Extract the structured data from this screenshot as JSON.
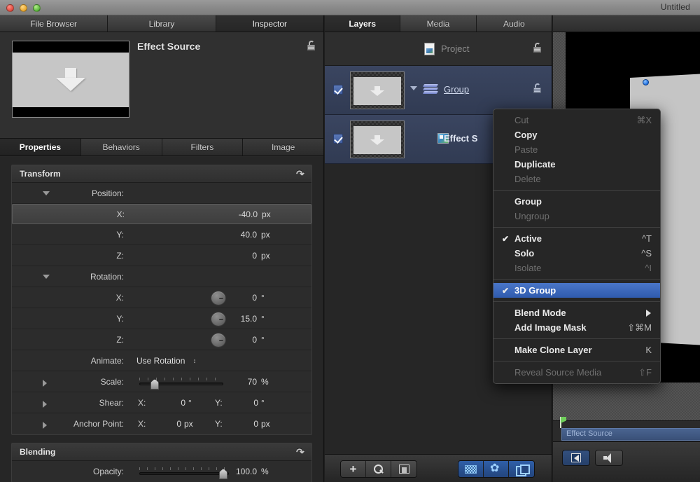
{
  "window": {
    "title": "Untitled"
  },
  "inspector": {
    "tabs": [
      {
        "label": "File Browser",
        "active": false
      },
      {
        "label": "Library",
        "active": false
      },
      {
        "label": "Inspector",
        "active": true
      }
    ],
    "header_title": "Effect Source",
    "subtabs": [
      {
        "label": "Properties",
        "active": true
      },
      {
        "label": "Behaviors",
        "active": false
      },
      {
        "label": "Filters",
        "active": false
      },
      {
        "label": "Image",
        "active": false
      }
    ],
    "transform": {
      "title": "Transform",
      "position_label": "Position:",
      "position": [
        {
          "label": "X:",
          "value": "-40.0",
          "unit": "px",
          "selected": true
        },
        {
          "label": "Y:",
          "value": "40.0",
          "unit": "px",
          "selected": false
        },
        {
          "label": "Z:",
          "value": "0",
          "unit": "px",
          "selected": false
        }
      ],
      "rotation_label": "Rotation:",
      "rotation": [
        {
          "label": "X:",
          "value": "0",
          "unit": "°"
        },
        {
          "label": "Y:",
          "value": "15.0",
          "unit": "°"
        },
        {
          "label": "Z:",
          "value": "0",
          "unit": "°"
        }
      ],
      "animate_label": "Animate:",
      "animate_value": "Use Rotation",
      "scale_label": "Scale:",
      "scale_value": "70",
      "scale_unit": "%",
      "shear_label": "Shear:",
      "shear_x_label": "X:",
      "shear_x_value": "0",
      "shear_x_unit": "°",
      "shear_y_label": "Y:",
      "shear_y_value": "0",
      "shear_y_unit": "°",
      "anchor_label": "Anchor Point:",
      "anchor_x_label": "X:",
      "anchor_x_value": "0",
      "anchor_x_unit": "px",
      "anchor_y_label": "Y:",
      "anchor_y_value": "0",
      "anchor_y_unit": "px"
    },
    "blending": {
      "title": "Blending",
      "opacity_label": "Opacity:",
      "opacity_value": "100.0",
      "opacity_unit": "%"
    }
  },
  "layers_panel": {
    "tabs": [
      {
        "label": "Layers",
        "active": true
      },
      {
        "label": "Media",
        "active": false
      },
      {
        "label": "Audio",
        "active": false
      }
    ],
    "project_row": {
      "label": "Project"
    },
    "rows": [
      {
        "name": "Group",
        "checked": true,
        "type": "group"
      },
      {
        "name": "Effect S",
        "checked": true,
        "type": "image"
      }
    ]
  },
  "context_menu": {
    "items": [
      {
        "label": "Cut",
        "shortcut": "⌘X",
        "state": "disabled",
        "check": false
      },
      {
        "label": "Copy",
        "shortcut": "",
        "state": "enabled",
        "check": false
      },
      {
        "label": "Paste",
        "shortcut": "",
        "state": "disabled",
        "check": false
      },
      {
        "label": "Duplicate",
        "shortcut": "",
        "state": "enabled",
        "check": false
      },
      {
        "label": "Delete",
        "shortcut": "",
        "state": "disabled",
        "check": false
      },
      {
        "label": "-SEP-"
      },
      {
        "label": "Group",
        "shortcut": "",
        "state": "enabled",
        "check": false
      },
      {
        "label": "Ungroup",
        "shortcut": "",
        "state": "disabled",
        "check": false
      },
      {
        "label": "-SEP-"
      },
      {
        "label": "Active",
        "shortcut": "^T",
        "state": "enabled",
        "check": true
      },
      {
        "label": "Solo",
        "shortcut": "^S",
        "state": "enabled",
        "check": false
      },
      {
        "label": "Isolate",
        "shortcut": "^I",
        "state": "disabled",
        "check": false
      },
      {
        "label": "-SEP-"
      },
      {
        "label": "3D Group",
        "shortcut": "",
        "state": "highlighted",
        "check": true
      },
      {
        "label": "-SEP-"
      },
      {
        "label": "Blend Mode",
        "shortcut": "",
        "state": "submenu",
        "check": false
      },
      {
        "label": "Add Image Mask",
        "shortcut": "⇧⌘M",
        "state": "enabled",
        "check": false
      },
      {
        "label": "-SEP-"
      },
      {
        "label": "Make Clone Layer",
        "shortcut": "K",
        "state": "enabled",
        "check": false
      },
      {
        "label": "-SEP-"
      },
      {
        "label": "Reveal Source Media",
        "shortcut": "⇧F",
        "state": "disabled",
        "check": false
      }
    ]
  },
  "timeline": {
    "clip_label": "Effect Source"
  },
  "colors": {
    "accent_blue": "#2f5bae",
    "selection_row": "#3a4560",
    "panel_bg": "#262626"
  }
}
